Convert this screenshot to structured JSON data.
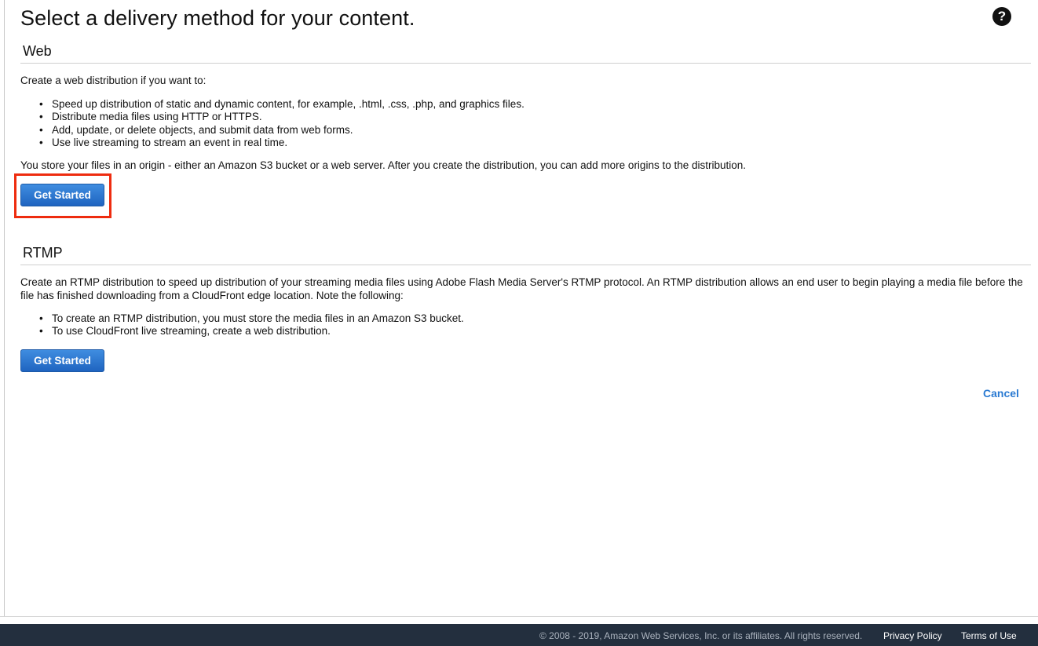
{
  "page": {
    "title": "Select a delivery method for your content.",
    "help_icon": "question-circle-icon"
  },
  "web": {
    "heading": "Web",
    "intro": "Create a web distribution if you want to:",
    "bullets": [
      "Speed up distribution of static and dynamic content, for example, .html, .css, .php, and graphics files.",
      "Distribute media files using HTTP or HTTPS.",
      "Add, update, or delete objects, and submit data from web forms.",
      "Use live streaming to stream an event in real time."
    ],
    "note": "You store your files in an origin - either an Amazon S3 bucket or a web server. After you create the distribution, you can add more origins to the distribution.",
    "button_label": "Get Started",
    "highlight_color": "#ee2c0f"
  },
  "rtmp": {
    "heading": "RTMP",
    "description": "Create an RTMP distribution to speed up distribution of your streaming media files using Adobe Flash Media Server's RTMP protocol. An RTMP distribution allows an end user to begin playing a media file before the file has finished downloading from a CloudFront edge location. Note the following:",
    "bullets": [
      "To create an RTMP distribution, you must store the media files in an Amazon S3 bucket.",
      "To use CloudFront live streaming, create a web distribution."
    ],
    "button_label": "Get Started"
  },
  "cancel_label": "Cancel",
  "footer": {
    "copyright": "© 2008 - 2019, Amazon Web Services, Inc. or its affiliates. All rights reserved.",
    "privacy_label": "Privacy Policy",
    "terms_label": "Terms of Use"
  },
  "colors": {
    "button": "#1f64c0",
    "link": "#2a7ad2",
    "footer_bg": "#232f3e"
  }
}
